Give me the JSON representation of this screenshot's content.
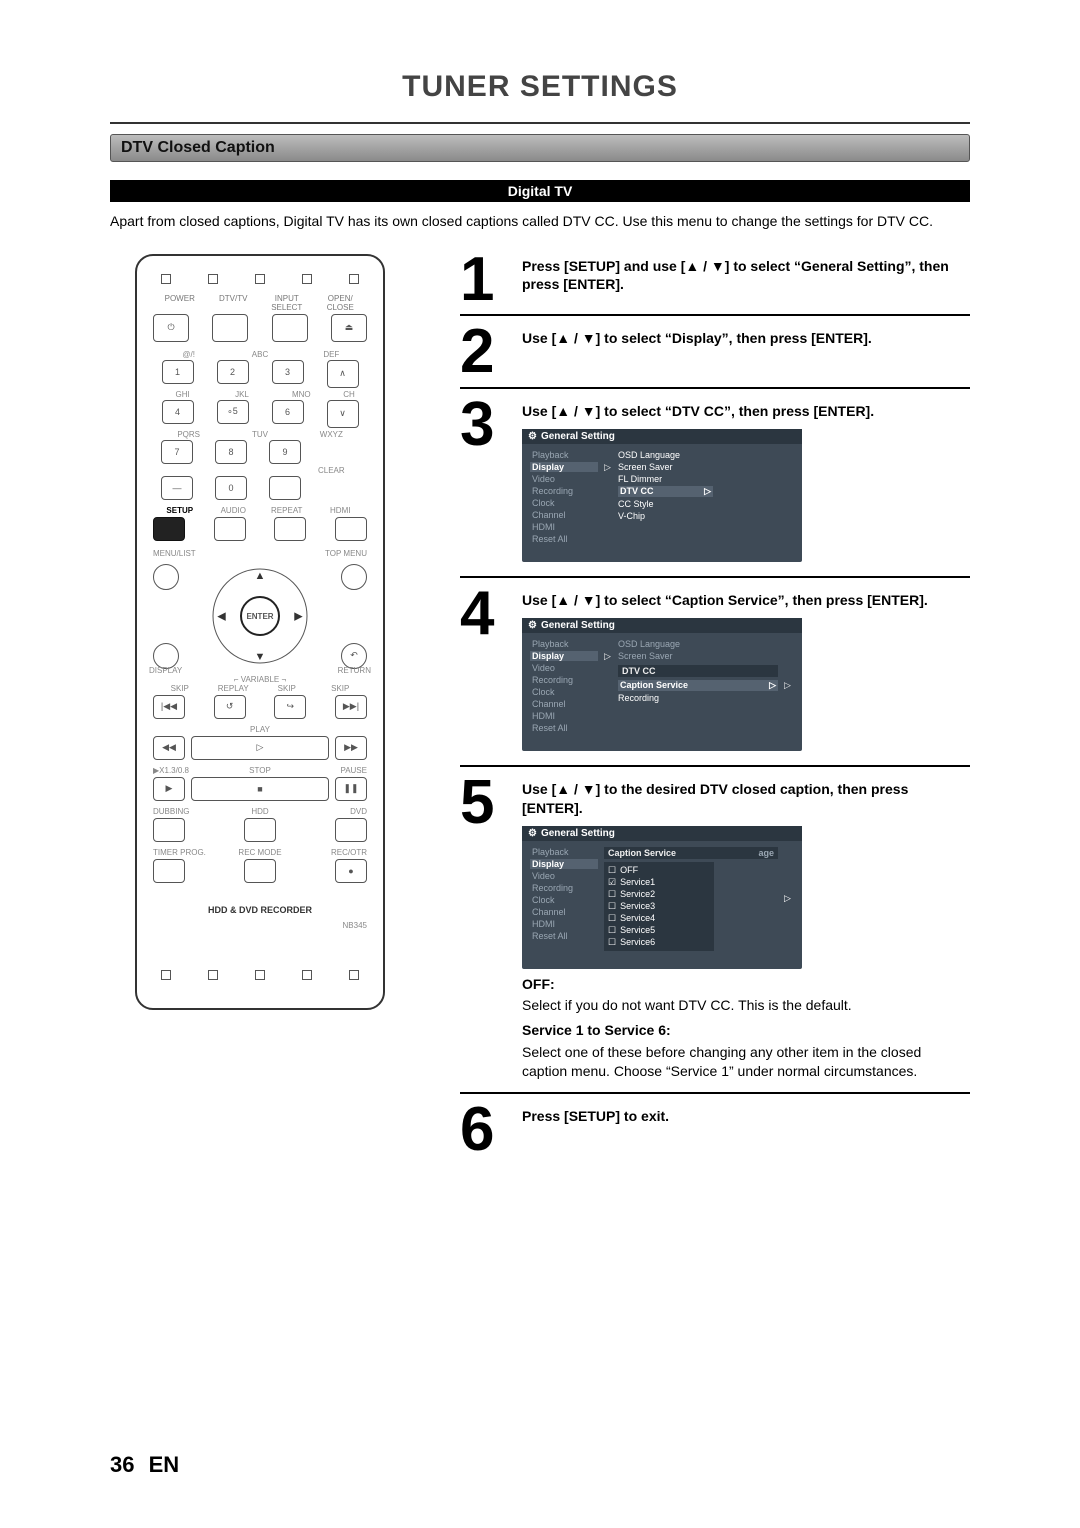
{
  "page": {
    "title": "TUNER SETTINGS",
    "section_heading": "DTV Closed Caption",
    "banner": "Digital TV",
    "intro": "Apart from closed captions, Digital TV has its own closed captions called DTV CC. Use this menu to change the settings for DTV CC.",
    "page_number": "36",
    "lang": "EN"
  },
  "remote": {
    "labels_top": [
      "POWER",
      "DTV/TV",
      "INPUT SELECT",
      "OPEN/ CLOSE"
    ],
    "numpad_top": [
      "@/!",
      "ABC",
      "DEF"
    ],
    "numpad_mid": [
      "GHI",
      "JKL",
      "MNO"
    ],
    "numpad_low": [
      "PQRS",
      "TUV",
      "WXYZ"
    ],
    "ch": "CH",
    "clear": "CLEAR",
    "zero": "0",
    "func_row": [
      "SETUP",
      "AUDIO",
      "REPEAT",
      "HDMI"
    ],
    "menu_list": "MENU/LIST",
    "top_menu": "TOP MENU",
    "display": "DISPLAY",
    "return": "RETURN",
    "enter": "ENTER",
    "variable": "VARIABLE",
    "skip": "SKIP",
    "replay": "REPLAY",
    "play": "PLAY",
    "x13": "▶X1.3/0.8",
    "stop": "STOP",
    "pause": "PAUSE",
    "dubbing": "DUBBING",
    "hdd": "HDD",
    "dvd": "DVD",
    "timer": "TIMER PROG.",
    "recmode": "REC MODE",
    "recotr": "REC/OTR",
    "caption": "HDD & DVD RECORDER",
    "model": "NB345"
  },
  "steps": {
    "s1": {
      "num": "1",
      "t1": "Press [SETUP] and use [",
      "t2": " / ",
      "t3": "] to select “General Setting”, then press [ENTER]."
    },
    "s2": {
      "num": "2",
      "t1": "Use [",
      "t2": " / ",
      "t3": "] to select “Display”, then press [ENTER]."
    },
    "s3": {
      "num": "3",
      "t1": "Use [",
      "t2": " / ",
      "t3": "] to select “DTV CC”, then press [ENTER]."
    },
    "s4": {
      "num": "4",
      "t1": "Use [",
      "t2": " / ",
      "t3": "] to select “Caption Service”, then press [ENTER]."
    },
    "s5": {
      "num": "5",
      "t1": "Use [",
      "t2": " / ",
      "t3": "] to the desired DTV closed caption, then press [ENTER].",
      "off_h": "OFF:",
      "off_t": "Select if you do not want DTV CC. This is the default.",
      "svc_h": "Service 1 to Service 6:",
      "svc_t": "Select one of these before changing any other item in the closed caption menu. Choose “Service 1” under normal circumstances."
    },
    "s6": {
      "num": "6",
      "t": "Press [SETUP] to exit."
    }
  },
  "osd": {
    "title": "General Setting",
    "menu": [
      "Playback",
      "Display",
      "Video",
      "Recording",
      "Clock",
      "Channel",
      "HDMI",
      "Reset All"
    ],
    "sub3": [
      "OSD Language",
      "Screen Saver",
      "FL Dimmer",
      "DTV CC",
      "CC Style",
      "V-Chip"
    ],
    "sub4_hdr": "DTV CC",
    "sub4": [
      "OSD Language",
      "Screen Saver"
    ],
    "sub4_items": [
      "Caption Service",
      "Recording"
    ],
    "sub5_hdr": "Caption Service",
    "opts": [
      "OFF",
      "Service1",
      "Service2",
      "Service3",
      "Service4",
      "Service5",
      "Service6"
    ],
    "opts_checked_index": 1,
    "ghost": "age"
  }
}
